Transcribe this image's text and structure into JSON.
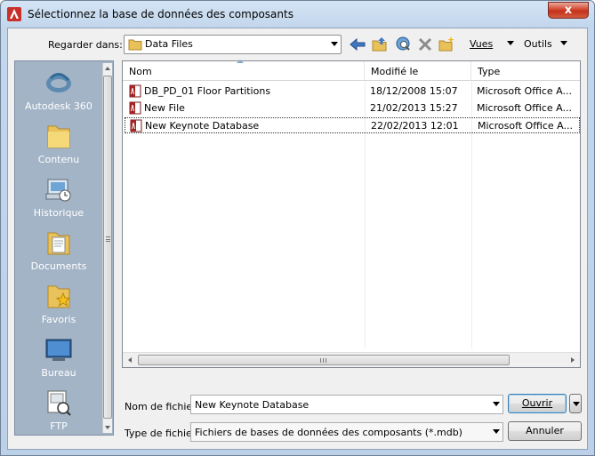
{
  "window": {
    "title": "Sélectionnez la base de données des composants",
    "close_label": "x"
  },
  "toolbar": {
    "look_in_label": "Regarder dans:",
    "look_in_value": "Data Files",
    "views_label": "Vues",
    "tools_label": "Outils"
  },
  "places": [
    {
      "label": "Autodesk 360",
      "icon": "autodesk-360-icon"
    },
    {
      "label": "Contenu",
      "icon": "folder-icon"
    },
    {
      "label": "Historique",
      "icon": "history-icon"
    },
    {
      "label": "Documents",
      "icon": "documents-icon"
    },
    {
      "label": "Favoris",
      "icon": "favorites-icon"
    },
    {
      "label": "Bureau",
      "icon": "desktop-icon"
    },
    {
      "label": "FTP",
      "icon": "ftp-icon"
    }
  ],
  "filelist": {
    "columns": [
      "Nom",
      "Modifié le",
      "Type"
    ],
    "rows": [
      {
        "name": "DB_PD_01 Floor Partitions",
        "modified": "18/12/2008 15:07",
        "type": "Microsoft Office A..."
      },
      {
        "name": "New File",
        "modified": "21/02/2013 15:27",
        "type": "Microsoft Office A..."
      },
      {
        "name": "New Keynote Database",
        "modified": "22/02/2013 12:01",
        "type": "Microsoft Office A..."
      }
    ],
    "selected_index": 2
  },
  "form": {
    "filename_label": "Nom de fichier:",
    "filename_value": "New Keynote Database",
    "filetype_label": "Type de fichier:",
    "filetype_value": "Fichiers de bases de données des composants (*.mdb)",
    "open_label": "Ouvrir",
    "cancel_label": "Annuler"
  },
  "colors": {
    "title_gradient": "#c2d6ec",
    "places_bg": "#a3b4c7",
    "close_red": "#c4301b"
  }
}
